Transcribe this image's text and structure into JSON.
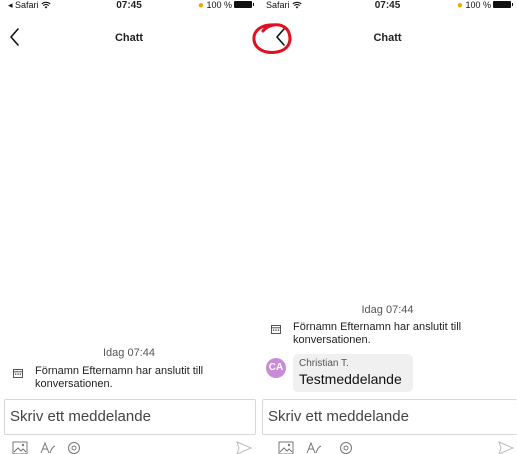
{
  "screens": [
    {
      "status": {
        "carrier": "◂ Safari",
        "time": "07:45",
        "battery": "100 %"
      },
      "nav": {
        "title": "Chatt"
      },
      "day_label": "Idag 07:44",
      "system_message": {
        "line1": "Förnamn Efternamn har anslutit till",
        "line2": "konversationen."
      },
      "composer": {
        "placeholder": "Skriv ett meddelande"
      }
    },
    {
      "status": {
        "carrier": "Safari",
        "time": "07:45",
        "battery": "100 %"
      },
      "nav": {
        "title": "Chatt"
      },
      "day_label": "Idag 07:44",
      "system_message": {
        "line1": "Förnamn Efternamn har anslutit till",
        "line2": "konversationen."
      },
      "message": {
        "avatar_initials": "CA",
        "sender": "Christian T.",
        "text": "Testmeddelande"
      },
      "composer": {
        "placeholder": "Skriv ett meddelande"
      }
    }
  ],
  "colors": {
    "avatar": "#c98ad8",
    "battery_dot": "#f0a400",
    "annotation": "#e0101e",
    "bubble": "#f0f0f0"
  },
  "icons": [
    "back-chevron-icon",
    "wifi-icon",
    "battery-icon",
    "calendar-icon",
    "image-icon",
    "text-format-icon",
    "location-icon",
    "send-icon"
  ]
}
